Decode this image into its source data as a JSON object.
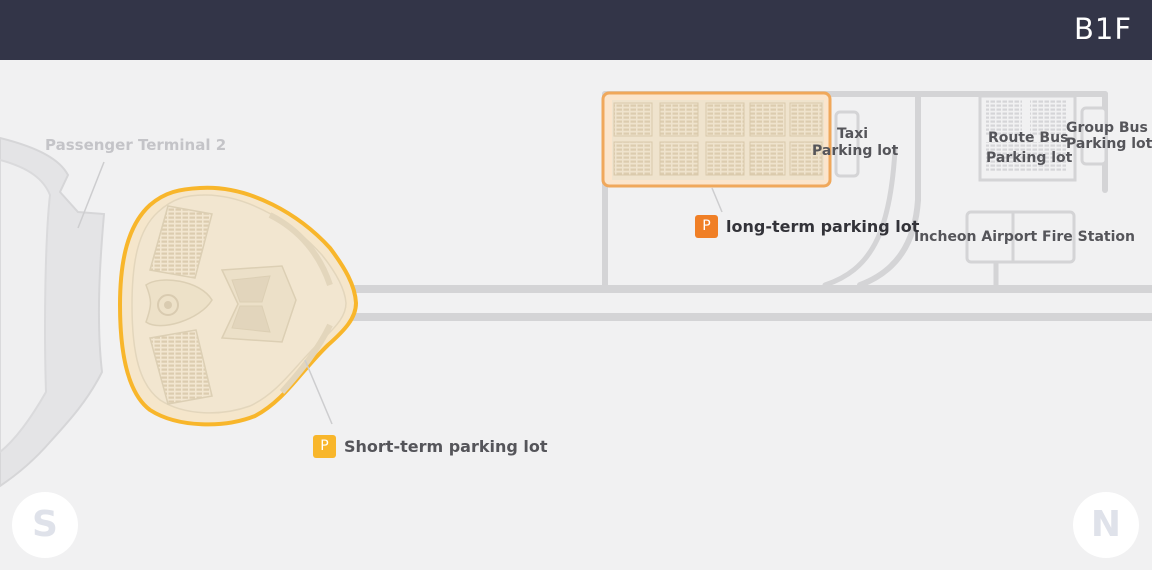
{
  "floor": "B1F",
  "labels": {
    "terminal": "Passenger Terminal 2",
    "taxi_line1": "Taxi",
    "taxi_line2": "Parking lot",
    "route_bus_line1": "Route Bus",
    "route_bus_line2": "Parking lot",
    "group_bus_line1": "Group Bus",
    "group_bus_line2": "Parking lot",
    "fire_station": "Incheon Airport Fire Station"
  },
  "parking": {
    "long_term": {
      "badge": "P",
      "label": "long-term parking lot",
      "color": "#f07f26"
    },
    "short_term": {
      "badge": "P",
      "label": "Short-term parking lot",
      "color": "#f8b62b"
    }
  },
  "compass": {
    "south": "S",
    "north": "N"
  },
  "colors": {
    "header_bg": "#333548",
    "map_bg": "#f1f1f2",
    "road": "#d4d4d6",
    "lot_fill": "#f5e6cb",
    "long_term_fill": "#fbe5cc"
  }
}
